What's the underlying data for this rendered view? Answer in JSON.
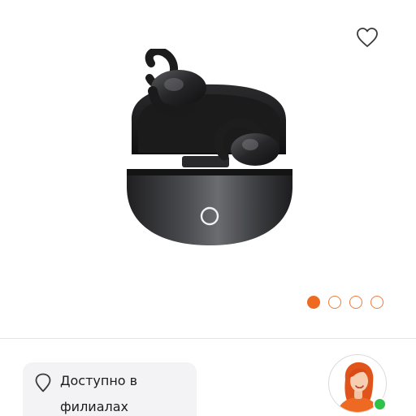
{
  "availability": {
    "line1": "Доступно в",
    "line2": "филиалах"
  },
  "gallery": {
    "slide_count": 4,
    "active_slide": 1
  },
  "colors": {
    "accent": "#ee6a22",
    "online": "#2ec24a",
    "panel_bg": "#f3f3f5"
  },
  "icons": {
    "favorite": "heart-icon",
    "location": "map-pin-icon",
    "status": "online-indicator"
  }
}
